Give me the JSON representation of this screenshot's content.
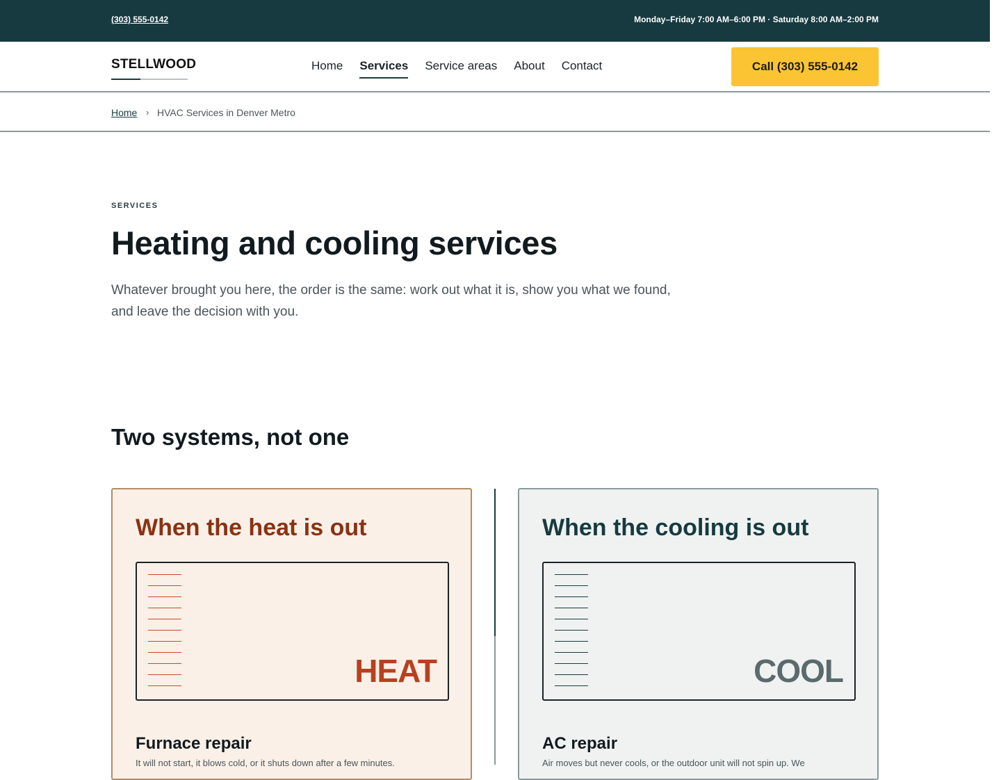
{
  "topbar": {
    "phone": "(303) 555-0142",
    "hours": "Monday–Friday 7:00 AM–6:00 PM · Saturday 8:00 AM–2:00 PM"
  },
  "nav": {
    "logo": "STELLWOOD",
    "items": [
      {
        "label": "Home",
        "active": false
      },
      {
        "label": "Services",
        "active": true
      },
      {
        "label": "Service areas",
        "active": false
      },
      {
        "label": "About",
        "active": false
      },
      {
        "label": "Contact",
        "active": false
      }
    ],
    "cta_label": "Call (303) 555-0142"
  },
  "breadcrumb": {
    "home": "Home",
    "separator": "›",
    "current": "HVAC Services in Denver Metro"
  },
  "hero": {
    "eyebrow": "SERVICES",
    "title": "Heating and cooling services",
    "lede": "Whatever brought you here, the order is the same: work out what it is, show you what we found, and leave the decision with you."
  },
  "systems": {
    "title": "Two systems, not one",
    "heat": {
      "title": "When the heat is out",
      "panel_label": "HEAT",
      "service_title": "Furnace repair",
      "service_text": "It will not start, it blows cold, or it shuts down after a few minutes."
    },
    "cool": {
      "title": "When the cooling is out",
      "panel_label": "COOL",
      "service_title": "AC repair",
      "service_text": "Air moves but never cools, or the outdoor unit will not spin up. We"
    }
  },
  "colors": {
    "topbar_bg": "#163a40",
    "cta_bg": "#fbc433",
    "heat_accent": "#8b3212",
    "cool_accent": "#163a40"
  }
}
